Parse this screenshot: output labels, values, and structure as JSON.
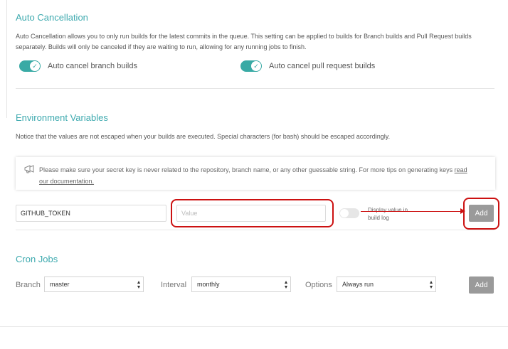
{
  "auto_cancellation": {
    "title": "Auto Cancellation",
    "description": "Auto Cancellation allows you to only run builds for the latest commits in the queue. This setting can be applied to builds for Branch builds and Pull Request builds separately. Builds will only be canceled if they are waiting to run, allowing for any running jobs to finish.",
    "branch_builds": {
      "label": "Auto cancel branch builds",
      "enabled": true
    },
    "pr_builds": {
      "label": "Auto cancel pull request builds",
      "enabled": true
    }
  },
  "env_vars": {
    "title": "Environment Variables",
    "description": "Notice that the values are not escaped when your builds are executed. Special characters (for bash) should be escaped accordingly.",
    "notice_text": "Please make sure your secret key is never related to the repository, branch name, or any other guessable string. For more tips on generating keys",
    "notice_link_1": "read",
    "notice_link_2": "our documentation.",
    "name_value": "GITHUB_TOKEN",
    "value_placeholder": "Value",
    "display_toggle_label_1": "Display value in",
    "display_toggle_label_2": "build log",
    "display_enabled": false,
    "add_label": "Add"
  },
  "cron_jobs": {
    "title": "Cron Jobs",
    "branch_label": "Branch",
    "branch_value": "master",
    "interval_label": "Interval",
    "interval_value": "monthly",
    "options_label": "Options",
    "options_value": "Always run",
    "add_label": "Add"
  },
  "colors": {
    "accent": "#3eaaaf",
    "toggle_on": "#39aaa5",
    "button": "#9a9a9a",
    "annotation": "#cc1111"
  }
}
